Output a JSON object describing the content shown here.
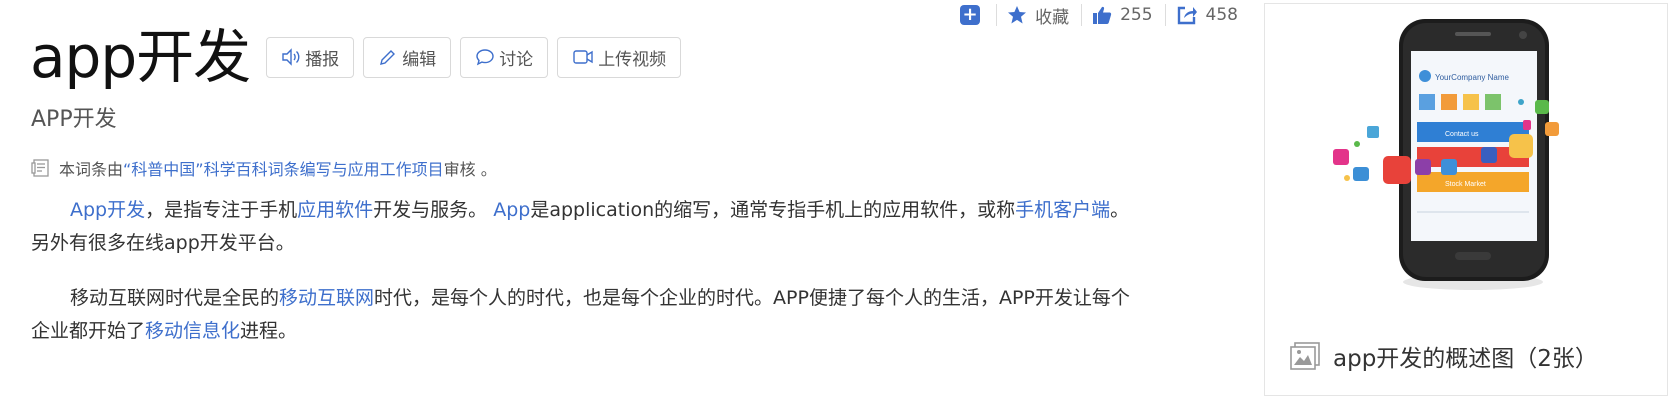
{
  "topbar": {
    "favorite_label": "收藏",
    "like_count": "255",
    "share_count": "458"
  },
  "title": "app开发",
  "buttons": {
    "broadcast": "播报",
    "edit": "编辑",
    "discuss": "讨论",
    "upload_video": "上传视频"
  },
  "subtitle": "APP开发",
  "review": {
    "prefix": "本词条由",
    "link": "“科普中国”科学百科词条编写与应用工作项目",
    "suffix": " 审核 。"
  },
  "paragraph1": {
    "link1": "App开发",
    "t1": "，是指专注于手机",
    "link2": "应用软件",
    "t2": "开发与服务。 ",
    "link3": "App",
    "t3": "是application的缩写，通常专指手机上的应用软件，或称",
    "link4": "手机客户端",
    "t4": "。另外有很多在线app开发平台。"
  },
  "paragraph2": {
    "t1": "移动互联网时代是全民的",
    "link1": "移动互联网",
    "t2": "时代，是每个人的时代，也是每个企业的时代。APP便捷了每个人的生活，APP开发让每个企业都开始了",
    "link2": "移动信息化",
    "t3": "进程。"
  },
  "card": {
    "phone_brand_text": "YourCompany Name",
    "phone_menu": [
      "Contact us",
      "Stock Market"
    ],
    "caption": "app开发的概述图（2张）"
  },
  "colors": {
    "link": "#3e6fcc",
    "accent": "#3e6fcc"
  }
}
